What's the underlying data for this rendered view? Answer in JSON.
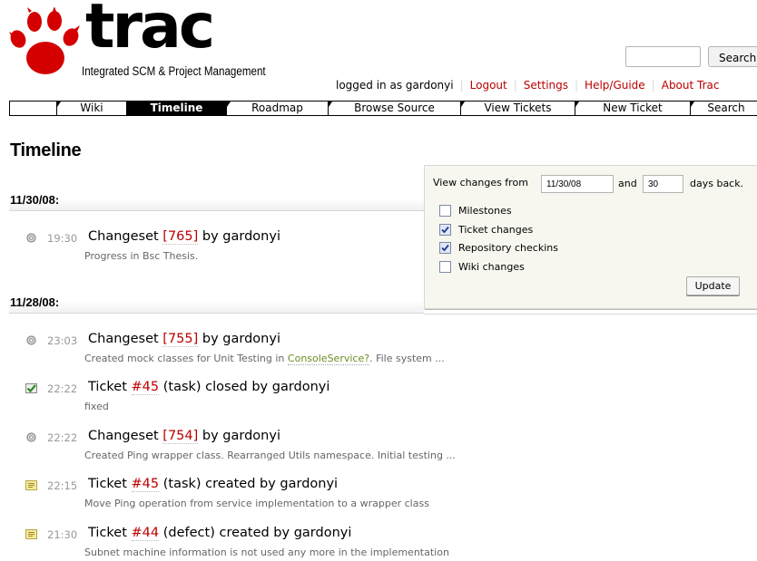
{
  "logo": {
    "word": "trac",
    "subtitle": "Integrated SCM & Project Management"
  },
  "search": {
    "button_label": "Search",
    "value": ""
  },
  "metanav": {
    "logged_in": "logged in as gardonyi",
    "links": [
      "Logout",
      "Settings",
      "Help/Guide",
      "About Trac"
    ]
  },
  "mainnav": {
    "tabs": [
      {
        "label": "Wiki",
        "active": false
      },
      {
        "label": "Timeline",
        "active": true
      },
      {
        "label": "Roadmap",
        "active": false
      },
      {
        "label": "Browse Source",
        "active": false
      },
      {
        "label": "View Tickets",
        "active": false
      },
      {
        "label": "New Ticket",
        "active": false
      },
      {
        "label": "Search",
        "active": false
      }
    ]
  },
  "page": {
    "title": "Timeline"
  },
  "prefs": {
    "view_changes_from": "View changes from",
    "from_value": "11/30/08",
    "and": "and",
    "days_value": "30",
    "days_back": "days back.",
    "filters": [
      {
        "label": "Milestones",
        "checked": false
      },
      {
        "label": "Ticket changes",
        "checked": true
      },
      {
        "label": "Repository checkins",
        "checked": true
      },
      {
        "label": "Wiki changes",
        "checked": false
      }
    ],
    "update_label": "Update"
  },
  "days": [
    {
      "date": "11/30/08:",
      "events": [
        {
          "icon": "changeset-icon",
          "time": "19:30",
          "pre": "Changeset ",
          "link": "[765]",
          "post": " by gardonyi",
          "desc": "Progress in Bsc Thesis.",
          "desc_link": "",
          "desc_post": ""
        }
      ]
    },
    {
      "date": "11/28/08:",
      "events": [
        {
          "icon": "changeset-icon",
          "time": "23:03",
          "pre": "Changeset ",
          "link": "[755]",
          "post": " by gardonyi",
          "desc": "Created mock classes for Unit Testing in ",
          "desc_link": "ConsoleService?",
          "desc_post": ". File system ..."
        },
        {
          "icon": "closed-ticket-icon",
          "time": "22:22",
          "pre": "Ticket ",
          "link": "#45",
          "post": " (task) closed by gardonyi",
          "desc": "fixed",
          "desc_link": "",
          "desc_post": ""
        },
        {
          "icon": "changeset-icon",
          "time": "22:22",
          "pre": "Changeset ",
          "link": "[754]",
          "post": " by gardonyi",
          "desc": "Created Ping wrapper class. Rearranged Utils namespace. Initial testing ...",
          "desc_link": "",
          "desc_post": ""
        },
        {
          "icon": "new-ticket-icon",
          "time": "22:15",
          "pre": "Ticket ",
          "link": "#45",
          "post": " (task) created by gardonyi",
          "desc": "Move Ping operation from service implementation to a wrapper class",
          "desc_link": "",
          "desc_post": ""
        },
        {
          "icon": "new-ticket-icon",
          "time": "21:30",
          "pre": "Ticket ",
          "link": "#44",
          "post": " (defect) created by gardonyi",
          "desc": "Subnet machine information is not used any more in the implementation",
          "desc_link": "",
          "desc_post": ""
        }
      ]
    }
  ]
}
